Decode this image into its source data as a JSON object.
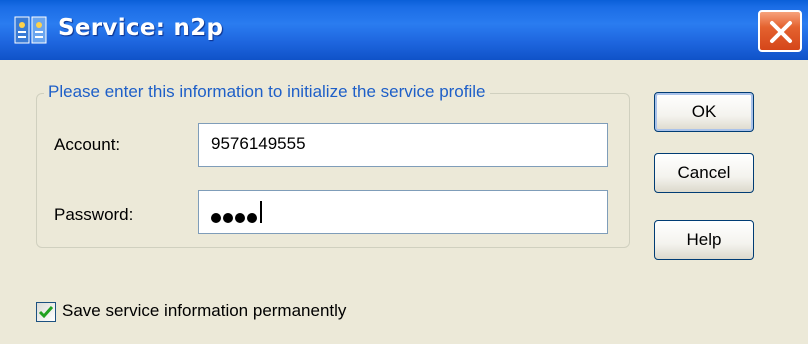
{
  "window": {
    "title": "Service: n2p",
    "icon": "service-app-icon",
    "close_icon": "close-icon",
    "close_color": "#d5461a",
    "titlebar_color": "#1e66df"
  },
  "form": {
    "group_legend": "Please enter this information to initialize the service profile",
    "account": {
      "label": "Account:",
      "value": "9576149555"
    },
    "password": {
      "label": "Password:",
      "masked_length": 4
    }
  },
  "buttons": {
    "ok": "OK",
    "cancel": "Cancel",
    "help": "Help"
  },
  "options": {
    "save_label": "Save service information permanently",
    "save_checked": true
  }
}
